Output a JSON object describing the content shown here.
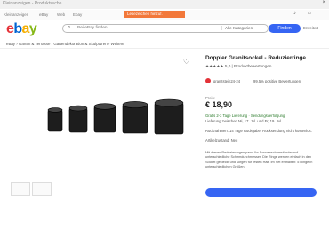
{
  "browser": {
    "tab_title": "Kleinanzeigen - Produktsuche"
  },
  "bookmarks": {
    "items": [
      "Kleinanzeigen",
      "eBay",
      "Web",
      "Ebay"
    ],
    "highlight": "Lesezeichen hinzuf."
  },
  "header": {
    "logo_letters": [
      "e",
      "b",
      "a",
      "y"
    ],
    "logo_colors": [
      "#e53238",
      "#0064d2",
      "#f5af02",
      "#86b817"
    ],
    "search_placeholder": "Bei eBay finden",
    "category": "Alle Kategorien",
    "search_button": "Finden",
    "advanced": "Erweitert"
  },
  "breadcrumb": "eBay  ›  Garten & Terrasse  ›  Gartendekoration & Skulpturen  ›  Weitere",
  "product": {
    "title": "Doppler Granitsockel - Reduzierringe",
    "rating_text": "★★★★★ 5,0 | Produktbewertungen",
    "seller": "granitstein24-24",
    "seller_extra": "99,5% positive Bewertungen",
    "price_label": "Preis:",
    "price": "€ 18,90",
    "shipping": "Gratis 2-3 Tage Lieferung · Sendungsverfolgung",
    "delivery": "Lieferung zwischen Mi, 17. Jul. und Fr, 19. Jul.",
    "returns": "Rücknahmen: 14 Tage Rückgabe. Rücksendung nicht kostenlos.",
    "quantity": "Artikelzustand: Neu",
    "description": "Mit diesen Reduzierringen passt Ihr Sonnenschirmständer auf unterschiedliche Schirmdurchmesser. Die Ringe werden einfach in den Sockel gesteckt und sorgen für festen Halt. Im Set enthalten: 5 Ringe in unterschiedlichen Größen."
  }
}
